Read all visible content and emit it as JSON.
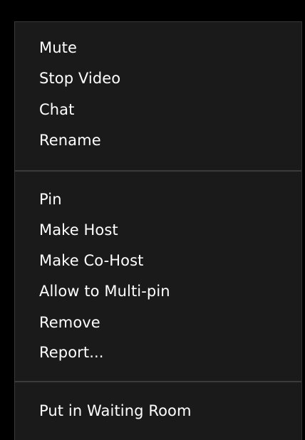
{
  "context_menu": {
    "groups": [
      {
        "items": [
          {
            "label": "Mute"
          },
          {
            "label": "Stop Video"
          },
          {
            "label": "Chat"
          },
          {
            "label": "Rename"
          }
        ]
      },
      {
        "items": [
          {
            "label": "Pin"
          },
          {
            "label": "Make Host"
          },
          {
            "label": "Make Co-Host"
          },
          {
            "label": "Allow to Multi-pin"
          },
          {
            "label": "Remove"
          },
          {
            "label": "Report..."
          }
        ]
      },
      {
        "items": [
          {
            "label": "Put in Waiting Room"
          }
        ]
      }
    ]
  },
  "colors": {
    "menu_background": "#1a1a1a",
    "text": "#ffffff",
    "divider": "#3a3a3a",
    "outer_background": "#000000"
  }
}
